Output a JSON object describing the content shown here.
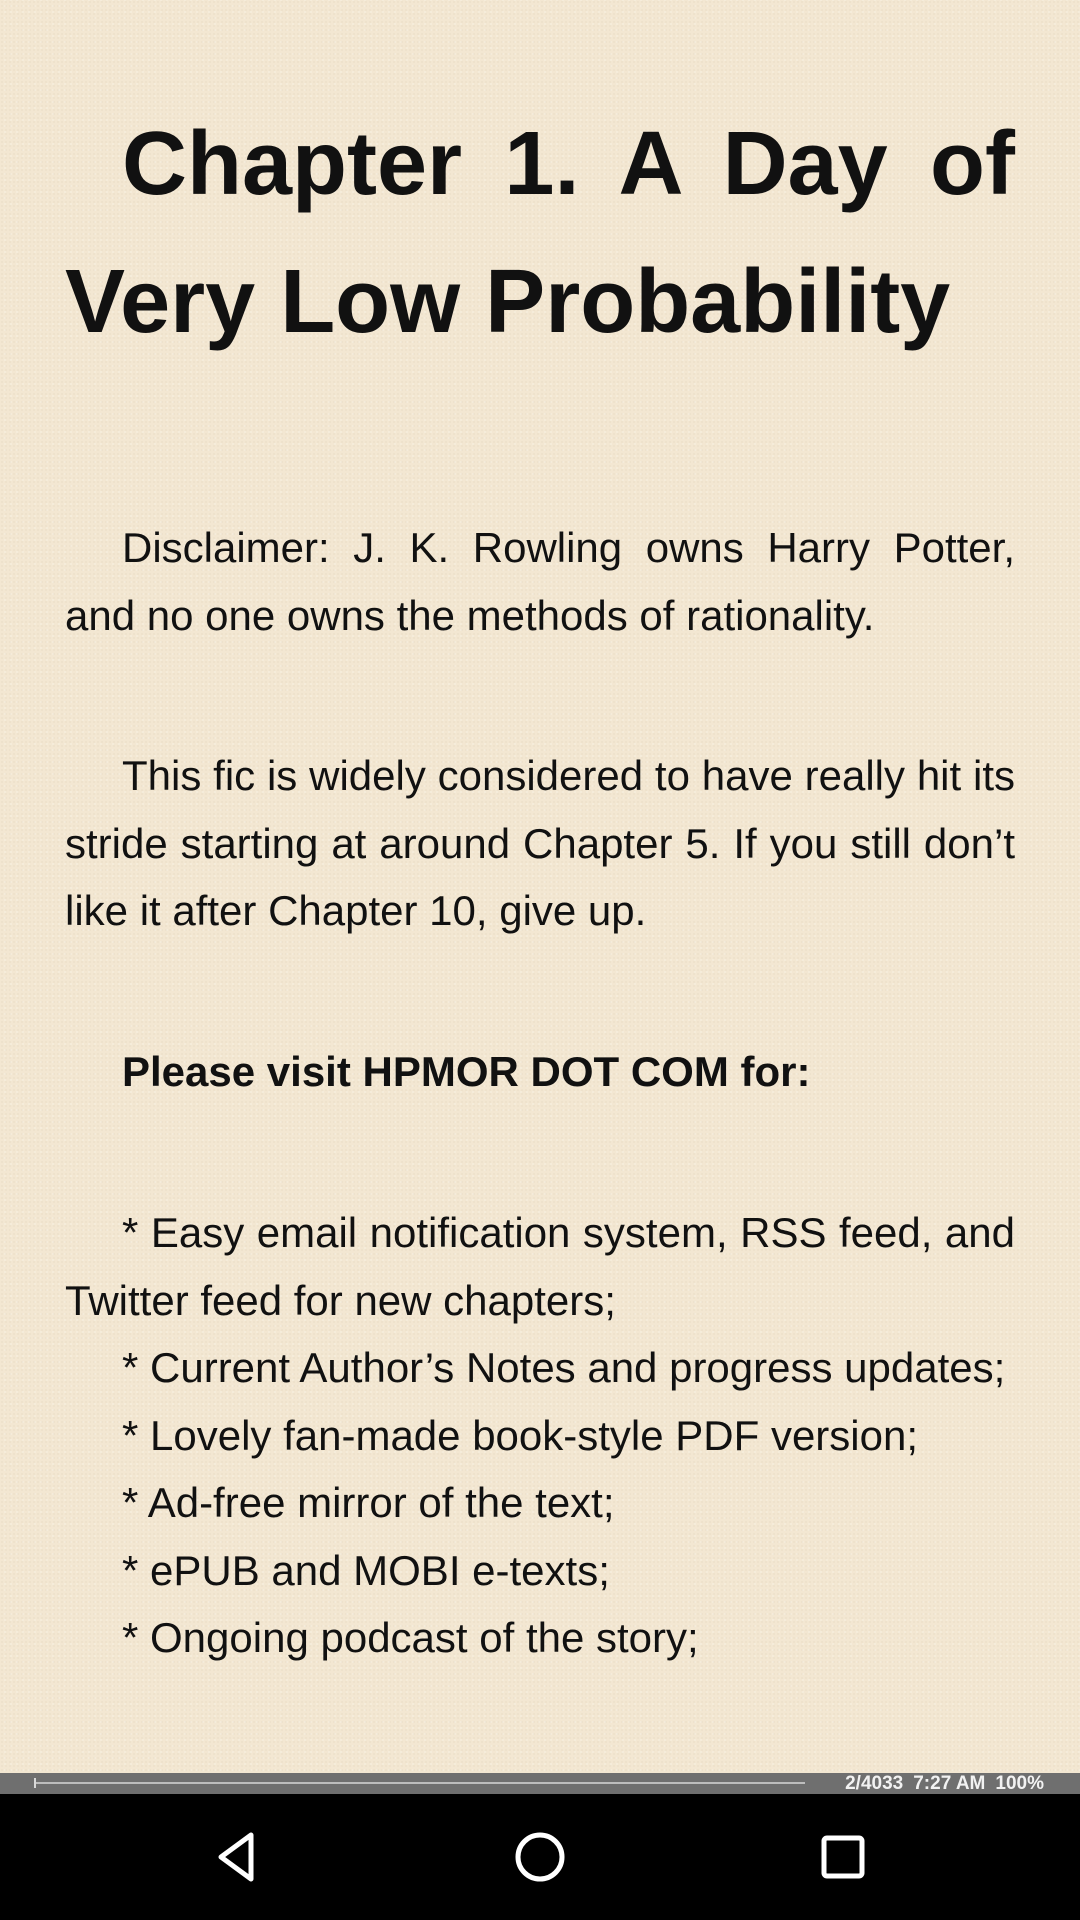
{
  "book": {
    "chapter_title": "Chapter 1. A Day of Very Low Probability",
    "disclaimer": "Disclaimer: J. K. Rowling owns Harry Potter, and no one owns the methods of rationality.",
    "intro": "This fic is widely considered to have really hit its stride starting at around Chapter 5. If you still don’t like it after Chapter 10, give up.",
    "visit_heading": "Please visit HPMOR DOT COM for:",
    "list_items": [
      "* Easy email notification system, RSS feed, and Twitter feed for new chapters;",
      "* Current Author’s Notes and progress updates;",
      "* Lovely fan-made book-style PDF version;",
      "* Ad-free mirror of the text;",
      "* ePUB and MOBI e-texts;",
      "* Ongoing podcast of the story;"
    ]
  },
  "status": {
    "page": "2/4033",
    "time": "7:27 AM",
    "battery": "100%",
    "progress_fraction": 0.0005
  },
  "nav": {
    "back_icon": "back-triangle-icon",
    "home_icon": "home-circle-icon",
    "recents_icon": "recents-square-icon"
  },
  "colors": {
    "page_background": "#f3e7d2",
    "text": "#111111",
    "status_bar": "#6f6f6f",
    "nav_bar": "#000000"
  }
}
